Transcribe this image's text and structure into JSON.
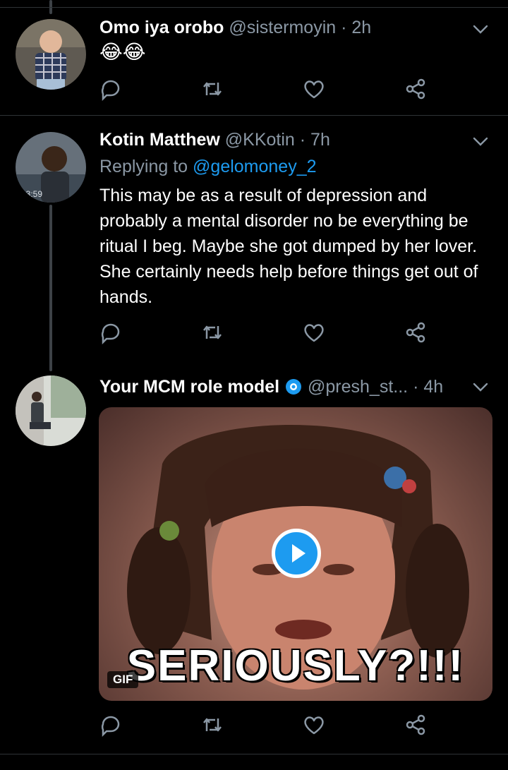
{
  "tweets": [
    {
      "name": "Omo iya orobo",
      "handle": "@sistermoyin",
      "time": "· 2h",
      "emoji": "😂😂"
    },
    {
      "name": "Kotin Matthew",
      "handle": "@KKotin",
      "time": "· 7h",
      "replying_prefix": "Replying to",
      "replying_to": "@gelomoney_2",
      "text": "This may be as a result of depression and probably a mental disorder no be everything be ritual I beg. Maybe she got dumped by her lover. She certainly needs help before things get out of hands."
    },
    {
      "name": "Your MCM role model",
      "handle": "@presh_st...",
      "time": "· 4h",
      "media": {
        "caption": "SERIOUSLY?!!!",
        "badge": "GIF"
      }
    }
  ],
  "colors": {
    "background": "#000000",
    "secondary_text": "#8b98a5",
    "accent": "#1d9bf0",
    "separator": "#2f3336"
  },
  "icons": {
    "reply": "reply-icon",
    "retweet": "retweet-icon",
    "like": "like-icon",
    "share": "share-icon",
    "more": "chevron-down-icon",
    "verified_like_badge": "view-badge-icon"
  }
}
